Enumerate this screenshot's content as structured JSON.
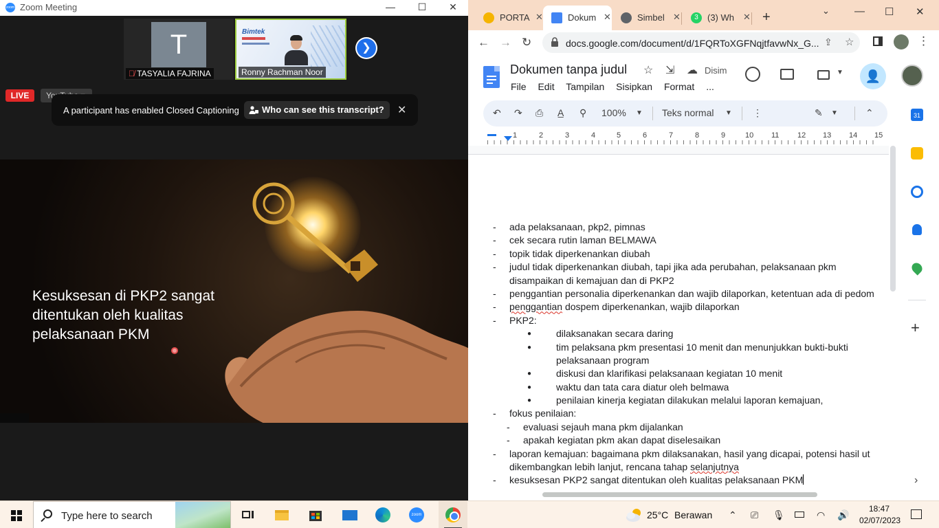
{
  "zoom": {
    "window_title": "Zoom Meeting",
    "participants": [
      {
        "initial": "T",
        "name": "TASYALIA FAJRINA",
        "muted": true
      },
      {
        "name": "Ronny Rachman Noor",
        "slide_brand": "Bimtek"
      }
    ],
    "live_label": "LIVE",
    "youtube_label": "YouTube ▾",
    "cc_message": "A participant has enabled Closed Captioning",
    "cc_button": "Who can see this transcript?",
    "slide_text": "Kesuksesan  di PKP2 sangat\nditentukan oleh kualitas\npelaksanaan PKM"
  },
  "chrome": {
    "tabs": [
      {
        "label": "PORTA",
        "active": false,
        "color": "#f5b400"
      },
      {
        "label": "Dokum",
        "active": true,
        "color": "#4285f4"
      },
      {
        "label": "Simbel",
        "active": false,
        "color": "#5f6368"
      },
      {
        "label": "(3) Wh",
        "active": false,
        "color": "#25d366",
        "badge": "3"
      }
    ],
    "url": "docs.google.com/document/d/1FQRToXGFNqjtfavwNx_G...",
    "accent": "#f8dcc7"
  },
  "docs": {
    "title": "Dokumen tanpa judul",
    "saved": "Disim",
    "menu": [
      "File",
      "Edit",
      "Tampilan",
      "Sisipkan",
      "Format",
      "..."
    ],
    "toolbar": {
      "zoom": "100%",
      "style": "Teks normal"
    },
    "ruler": [
      "1",
      "2",
      "3",
      "4",
      "5",
      "6",
      "7",
      "8",
      "9",
      "10",
      "11",
      "12",
      "13",
      "14",
      "15"
    ],
    "lines": [
      {
        "marker": "-",
        "indent": 0,
        "text": "ada pelaksanaan, pkp2, pimnas"
      },
      {
        "marker": "-",
        "indent": 0,
        "text": "cek secara rutin laman BELMAWA"
      },
      {
        "marker": "-",
        "indent": 0,
        "text": "topik tidak diperkenankan diubah"
      },
      {
        "marker": "-",
        "indent": 0,
        "text": "judul tidak diperkenankan diubah, tapi jika ada perubahan, pelaksanaan pkm"
      },
      {
        "marker": "",
        "indent": 0,
        "text": "disampaikan di kemajuan dan di PKP2"
      },
      {
        "marker": "-",
        "indent": 0,
        "text": "penggantian personalia diperkenankan dan wajib dilaporkan, ketentuan ada di pedom"
      },
      {
        "marker": "-",
        "indent": 0,
        "text": "penggantian dospem diperkenankan, wajib dilaporkan",
        "squiggle": "penggantian"
      },
      {
        "marker": "-",
        "indent": 0,
        "text": "PKP2:"
      },
      {
        "marker": "●",
        "indent": 2,
        "text": "dilaksanakan secara daring"
      },
      {
        "marker": "●",
        "indent": 2,
        "text": "tim pelaksana pkm presentasi 10 menit dan menunjukkan bukti-bukti"
      },
      {
        "marker": "",
        "indent": 2,
        "text": "pelaksanaan program"
      },
      {
        "marker": "●",
        "indent": 2,
        "text": "diskusi dan klarifikasi pelaksanaan kegiatan 10 menit"
      },
      {
        "marker": "●",
        "indent": 2,
        "text": "waktu dan tata cara diatur oleh belmawa"
      },
      {
        "marker": "●",
        "indent": 2,
        "text": "penilaian kinerja kegiatan dilakukan melalui laporan kemajuan,"
      },
      {
        "marker": "-",
        "indent": 0,
        "text": "fokus penilaian:"
      },
      {
        "marker": "-",
        "indent": 1,
        "text": "evaluasi sejauh mana pkm dijalankan"
      },
      {
        "marker": "-",
        "indent": 1,
        "text": "apakah kegiatan pkm akan dapat diselesaikan"
      },
      {
        "marker": "-",
        "indent": 0,
        "text": "laporan kemajuan: bagaimana pkm dilaksanakan, hasil yang dicapai, potensi hasil ut"
      },
      {
        "marker": "",
        "indent": 0,
        "text": "dikembangkan lebih lanjut, rencana tahap selanjutnya",
        "squiggle": "selanjutnya"
      },
      {
        "marker": "-",
        "indent": 0,
        "text": "kesuksesan PKP2 sangat ditentukan oleh kualitas pelaksanaan PKM",
        "caret": true
      }
    ]
  },
  "taskbar": {
    "search_placeholder": "Type here to search",
    "weather_temp": "25°C",
    "weather_desc": "Berawan",
    "time": "18:47",
    "date": "02/07/2023"
  }
}
